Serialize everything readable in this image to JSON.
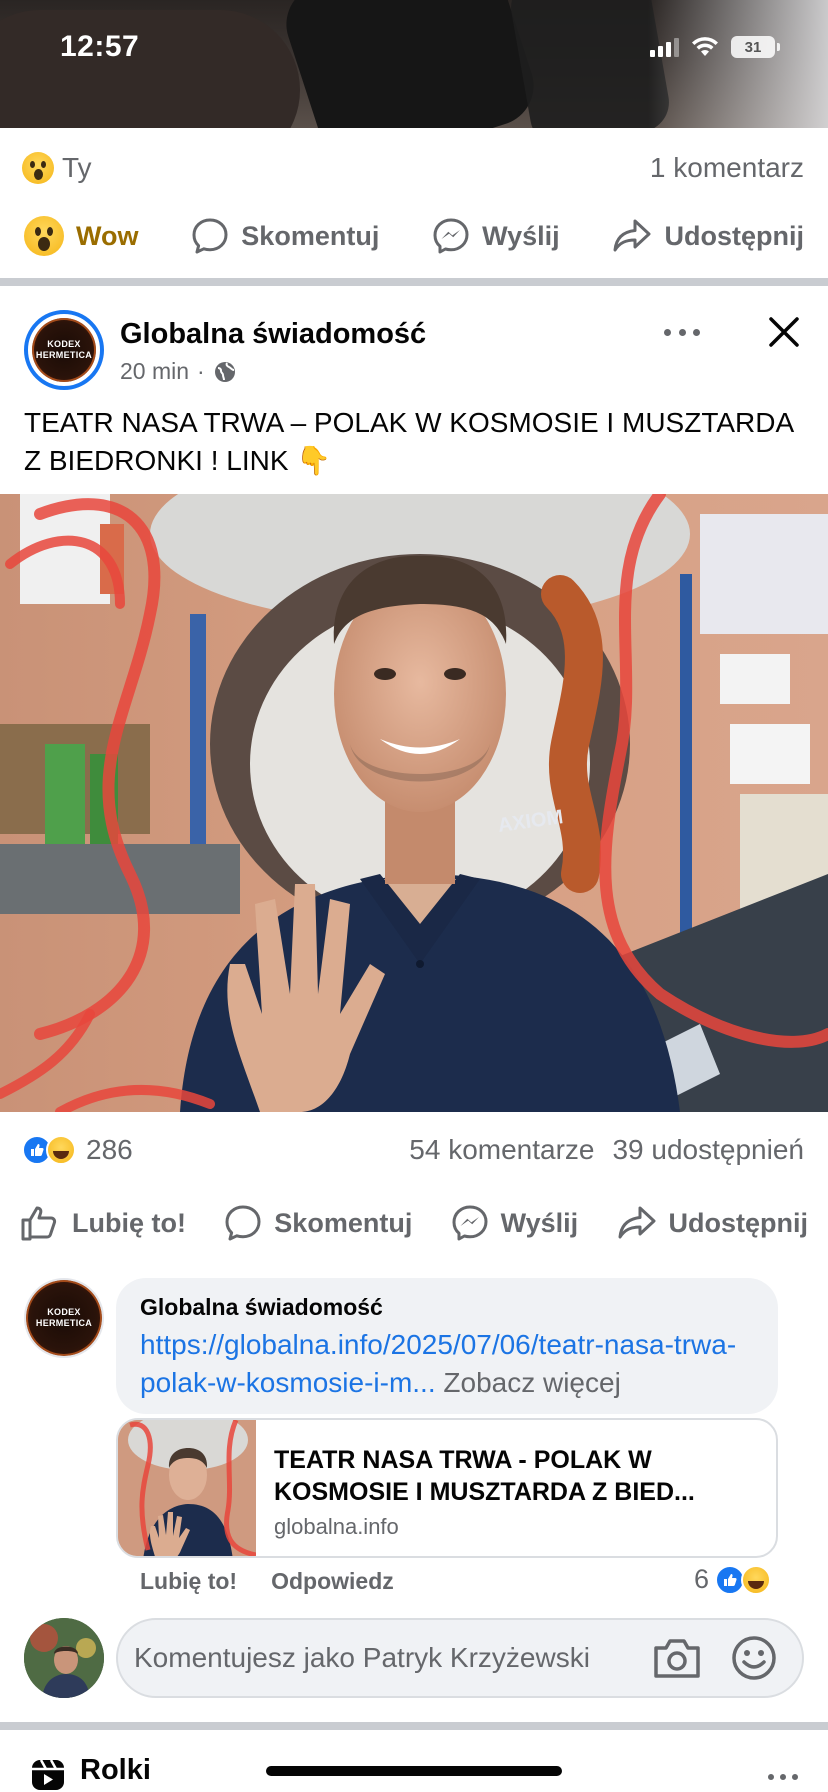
{
  "status_bar": {
    "time": "12:57",
    "battery": "31"
  },
  "previous_post": {
    "reaction_label": "Ty",
    "reaction_icon": "wow-emoji-icon",
    "comment_count": "1 komentarz",
    "actions": {
      "reaction": "Wow",
      "comment": "Skomentuj",
      "send": "Wyślij",
      "share": "Udostępnij"
    }
  },
  "post": {
    "author": "Globalna świadomość",
    "avatar_text_line1": "KODEX",
    "avatar_text_line2": "HERMETICA",
    "time": "20 min",
    "separator": "·",
    "text": "TEATR NASA TRWA – POLAK W KOSMOSIE I MUSZTARDA Z BIEDRONKI ! LINK 👇",
    "image_shirt_logo": "AXIOM",
    "stats": {
      "reactions_count": "286",
      "comments": "54 komentarze",
      "shares": "39 udostępnień"
    },
    "actions": {
      "like": "Lubię to!",
      "comment": "Skomentuj",
      "send": "Wyślij",
      "share": "Udostępnij"
    }
  },
  "comment": {
    "author": "Globalna świadomość",
    "link_text": "https://globalna.info/2025/07/06/teatr-nasa-trwa-polak-w-kosmosie-i-m...",
    "see_more": "Zobacz więcej",
    "link_card": {
      "title": "TEATR NASA TRWA - POLAK W KOSMOSIE I MUSZTARDA Z BIED...",
      "domain": "globalna.info"
    },
    "actions": {
      "like": "Lubię to!",
      "reply": "Odpowiedz"
    },
    "reaction_count": "6"
  },
  "composer": {
    "placeholder": "Komentujesz jako Patryk Krzyżewski"
  },
  "next_section": {
    "label": "Rolki"
  },
  "colors": {
    "accent": "#1877f2",
    "link": "#1b74e4",
    "secondary_text": "#65676b",
    "wow": "#9a6d00",
    "divider": "#c9ccd1"
  }
}
